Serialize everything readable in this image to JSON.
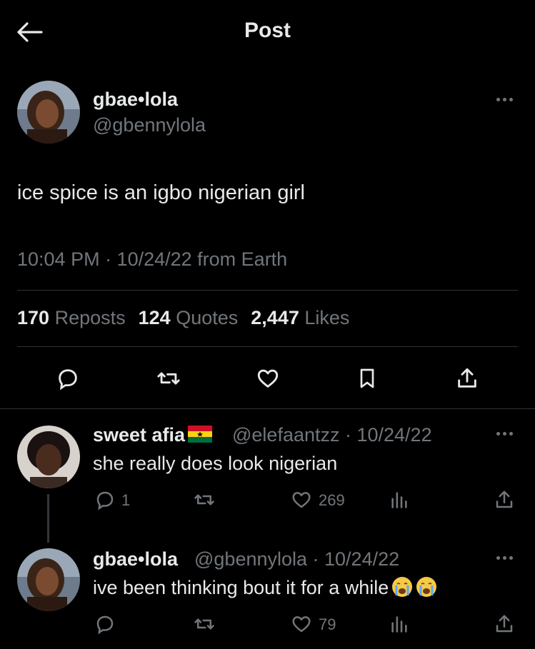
{
  "header": {
    "title": "Post",
    "back_icon": "arrow-left-icon"
  },
  "post": {
    "author": {
      "name": "gbae•lola",
      "handle": "@gbennylola"
    },
    "text": "ice spice is an igbo nigerian girl",
    "meta": "10:04 PM · 10/24/22 from Earth",
    "stats": [
      {
        "value": "170",
        "label": "Reposts"
      },
      {
        "value": "124",
        "label": "Quotes"
      },
      {
        "value": "2,447",
        "label": "Likes"
      }
    ],
    "actions": [
      "reply-icon",
      "repost-icon",
      "like-icon",
      "bookmark-icon",
      "share-icon"
    ]
  },
  "replies": [
    {
      "name": "sweet afia",
      "name_emoji": "ghana-flag",
      "handle": "@elefaantzz · 10/24/22",
      "text": "she really does look nigerian",
      "reply_count": "1",
      "like_count": "269"
    },
    {
      "name": "gbae•lola",
      "handle": "@gbennylola · 10/24/22",
      "text": "ive been thinking bout it for a while",
      "text_emoji": "crying-face x2",
      "reply_count": "",
      "like_count": "79"
    }
  ],
  "colors": {
    "background": "#000000",
    "text": "#e7e9ea",
    "muted": "#71767b",
    "divider": "#2f3336"
  }
}
